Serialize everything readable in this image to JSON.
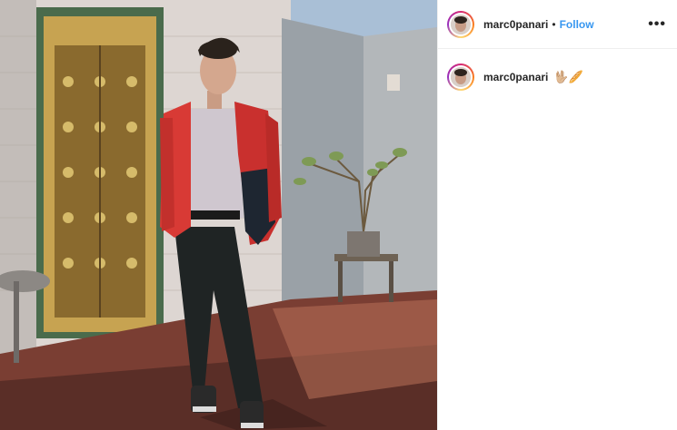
{
  "post": {
    "author": {
      "username": "marc0panari",
      "follow_label": "Follow",
      "separator": "•"
    },
    "more_label": "•••",
    "caption": {
      "username": "marc0panari",
      "text": "🖖🏼🥖"
    },
    "photo": {
      "icon": "photo-image"
    }
  },
  "colors": {
    "link_blue": "#3897f0",
    "text_dark": "#262626",
    "divider": "#efefef"
  }
}
